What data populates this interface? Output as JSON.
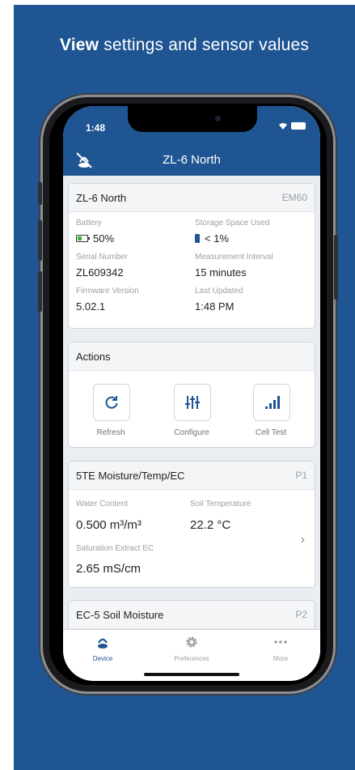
{
  "headline": {
    "bold": "View",
    "rest": " settings and sensor values"
  },
  "status_bar": {
    "time": "1:48"
  },
  "nav": {
    "title": "ZL-6 North"
  },
  "device_card": {
    "title": "ZL-6 North",
    "tag": "EM60",
    "battery_label": "Battery",
    "battery_value": "50%",
    "storage_label": "Storage Space Used",
    "storage_value": "< 1%",
    "serial_label": "Serial Number",
    "serial_value": "ZL609342",
    "interval_label": "Measurement Interval",
    "interval_value": "15 minutes",
    "firmware_label": "Firmware Version",
    "firmware_value": "5.02.1",
    "updated_label": "Last Updated",
    "updated_value": "1:48 PM"
  },
  "actions_card": {
    "title": "Actions",
    "refresh": "Refresh",
    "configure": "Configure",
    "cell_test": "Cell Test"
  },
  "sensor_card": {
    "title": "5TE Moisture/Temp/EC",
    "tag": "P1",
    "water_label": "Water Content",
    "water_value": "0.500 m³/m³",
    "temp_label": "Soil Temperature",
    "temp_value": "22.2 °C",
    "ec_label": "Saturation Extract EC",
    "ec_value": "2.65 mS/cm"
  },
  "sensor_card_2": {
    "title": "EC-5 Soil Moisture",
    "tag": "P2"
  },
  "tabs": [
    {
      "label": "Device",
      "icon": "device-icon",
      "active": true
    },
    {
      "label": "Preferences",
      "icon": "gear-icon",
      "active": false
    },
    {
      "label": "More",
      "icon": "more-dots-icon",
      "active": false
    }
  ],
  "colors": {
    "brand": "#1f5592",
    "battery_green": "#35b24a"
  }
}
